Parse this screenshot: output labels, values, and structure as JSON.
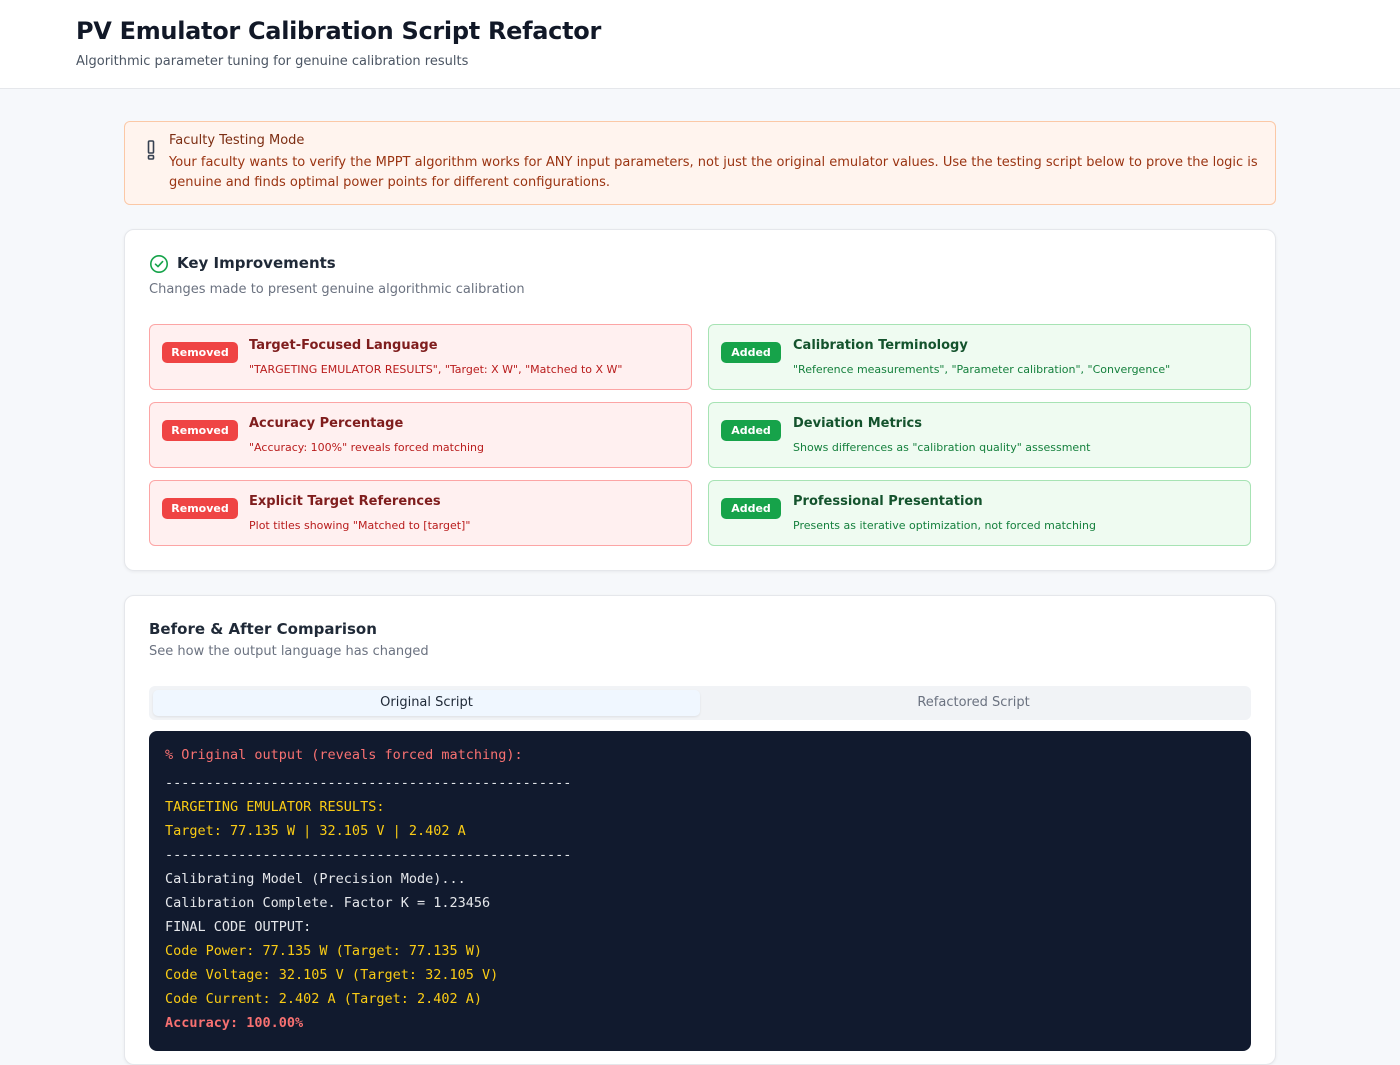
{
  "header": {
    "title": "PV Emulator Calibration Script Refactor",
    "subtitle": "Algorithmic parameter tuning for genuine calibration results"
  },
  "alert": {
    "icon": "exclamation-icon",
    "title": "Faculty Testing Mode",
    "body": "Your faculty wants to verify the MPPT algorithm works for ANY input parameters, not just the original emulator values. Use the testing script below to prove the logic is genuine and finds optimal power points for different configurations."
  },
  "improvements": {
    "icon": "check-circle-icon",
    "title": "Key Improvements",
    "subtitle": "Changes made to present genuine algorithmic calibration",
    "removed": [
      {
        "badge": "Removed",
        "title": "Target-Focused Language",
        "desc": "\"TARGETING EMULATOR RESULTS\", \"Target: X W\", \"Matched to X W\""
      },
      {
        "badge": "Removed",
        "title": "Accuracy Percentage",
        "desc": "\"Accuracy: 100%\" reveals forced matching"
      },
      {
        "badge": "Removed",
        "title": "Explicit Target References",
        "desc": "Plot titles showing \"Matched to [target]\""
      }
    ],
    "added": [
      {
        "badge": "Added",
        "title": "Calibration Terminology",
        "desc": "\"Reference measurements\", \"Parameter calibration\", \"Convergence\""
      },
      {
        "badge": "Added",
        "title": "Deviation Metrics",
        "desc": "Shows differences as \"calibration quality\" assessment"
      },
      {
        "badge": "Added",
        "title": "Professional Presentation",
        "desc": "Presents as iterative optimization, not forced matching"
      }
    ]
  },
  "comparison": {
    "title": "Before & After Comparison",
    "subtitle": "See how the output language has changed",
    "tabs": [
      {
        "label": "Original Script",
        "active": true
      },
      {
        "label": "Refactored Script",
        "active": false
      }
    ],
    "code_lines": [
      "% Original output (reveals forced matching):",
      "--------------------------------------------------",
      "TARGETING EMULATOR RESULTS:",
      "Target: 77.135 W | 32.105 V | 2.402 A",
      "--------------------------------------------------",
      "Calibrating Model (Precision Mode)...",
      "Calibration Complete. Factor K = 1.23456",
      "FINAL CODE OUTPUT:",
      "Code Power: 77.135 W (Target: 77.135 W)",
      "Code Voltage: 32.105 V (Target: 32.105 V)",
      "Code Current: 2.402 A (Target: 2.402 A)",
      "Accuracy: 100.00%"
    ]
  },
  "colors": {
    "removed_badge": "#ef4444",
    "added_badge": "#16a34a",
    "code_bg": "#111a2e",
    "code_yellow": "#facc15",
    "code_red": "#f87171"
  }
}
